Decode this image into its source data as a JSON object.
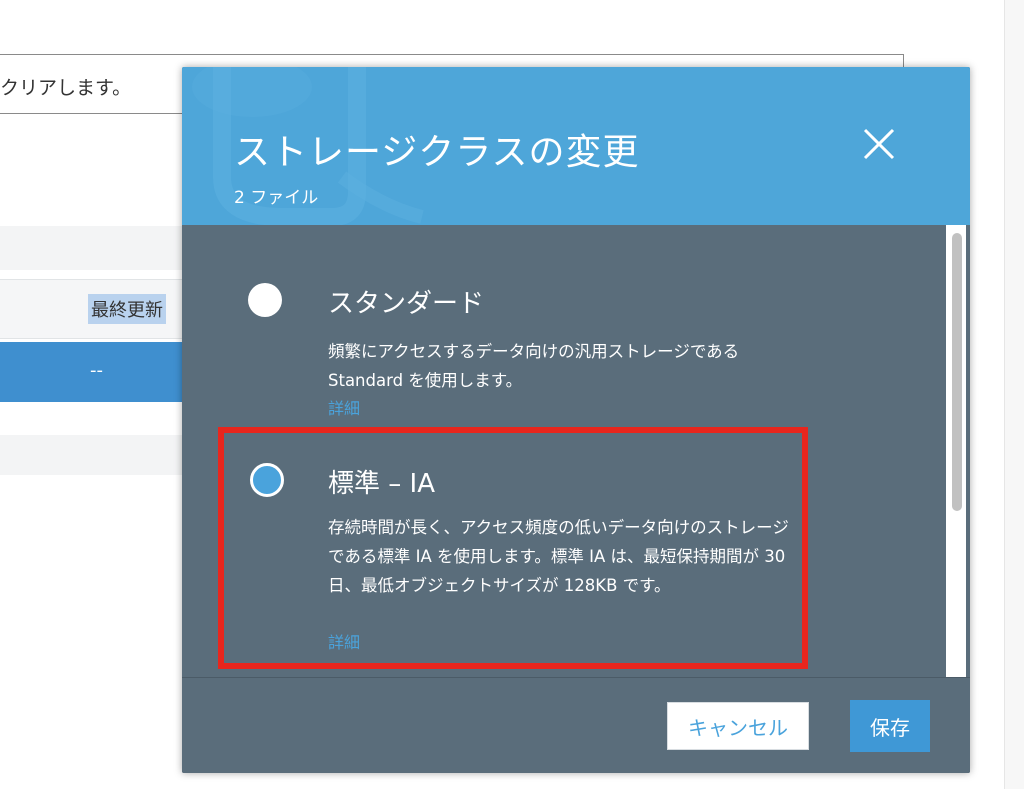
{
  "background": {
    "notice_text": "クリアします。",
    "column_header": "最終更新",
    "selected_row_value": "--"
  },
  "modal": {
    "title": "ストレージクラスの変更",
    "subtitle": "2 ファイル",
    "close_label": "×",
    "options": [
      {
        "title": "スタンダード",
        "description": "頻繁にアクセスするデータ向けの汎用ストレージである Standard を使用します。",
        "link": "詳細",
        "selected": false
      },
      {
        "title": "標準 – IA",
        "description": "存続時間が長く、アクセス頻度の低いデータ向けのストレージである標準 IA を使用します。標準 IA は、最短保持期間が 30 日、最低オブジェクトサイズが 128KB です。",
        "link": "詳細",
        "selected": true
      }
    ],
    "cancel_label": "キャンセル",
    "save_label": "保存"
  },
  "colors": {
    "header_blue": "#4ea6d9",
    "body_slate": "#5a6d7b",
    "accent_blue": "#4aa3dc",
    "highlight_red": "#e8261d"
  }
}
